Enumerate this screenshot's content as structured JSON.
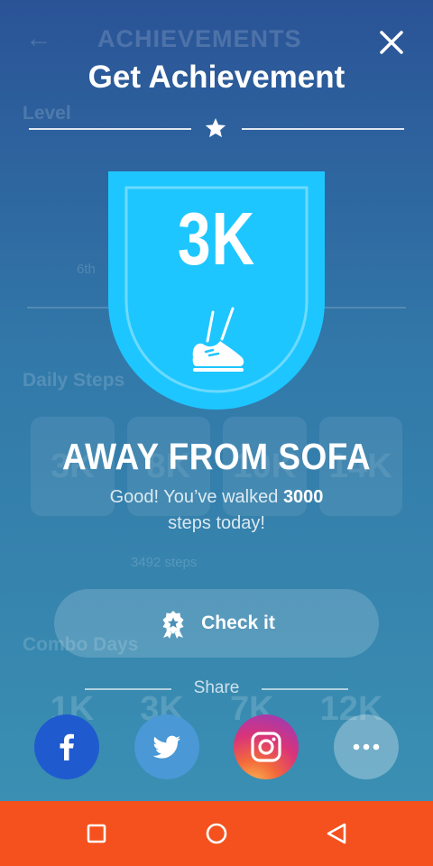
{
  "background_page": {
    "title": "ACHIEVEMENTS",
    "sections": [
      "Level",
      "Daily Steps",
      "Combo Days"
    ],
    "level_left": "6th",
    "daily_cards": [
      "3K",
      "8K",
      "10K",
      "14K"
    ],
    "combo_values": [
      "1K",
      "3K",
      "7K",
      "12K"
    ],
    "steps_text": "3492 steps"
  },
  "dialog": {
    "title": "Get Achievement",
    "badge_label": "3K",
    "achievement_name": "AWAY FROM SOFA",
    "desc_prefix": "Good! You’ve walked",
    "desc_value": "3000",
    "desc_suffix": "steps today!",
    "check_button_label": "Check it",
    "share_label": "Share"
  },
  "social": [
    {
      "name": "facebook",
      "icon": "facebook-icon"
    },
    {
      "name": "twitter",
      "icon": "twitter-icon"
    },
    {
      "name": "instagram",
      "icon": "instagram-icon"
    },
    {
      "name": "more",
      "icon": "more-icon"
    }
  ],
  "colors": {
    "badge_blue": "#1ec6ff",
    "facebook": "#1f5bcf",
    "twitter": "#4a98d6",
    "navbar": "#f4511e"
  }
}
